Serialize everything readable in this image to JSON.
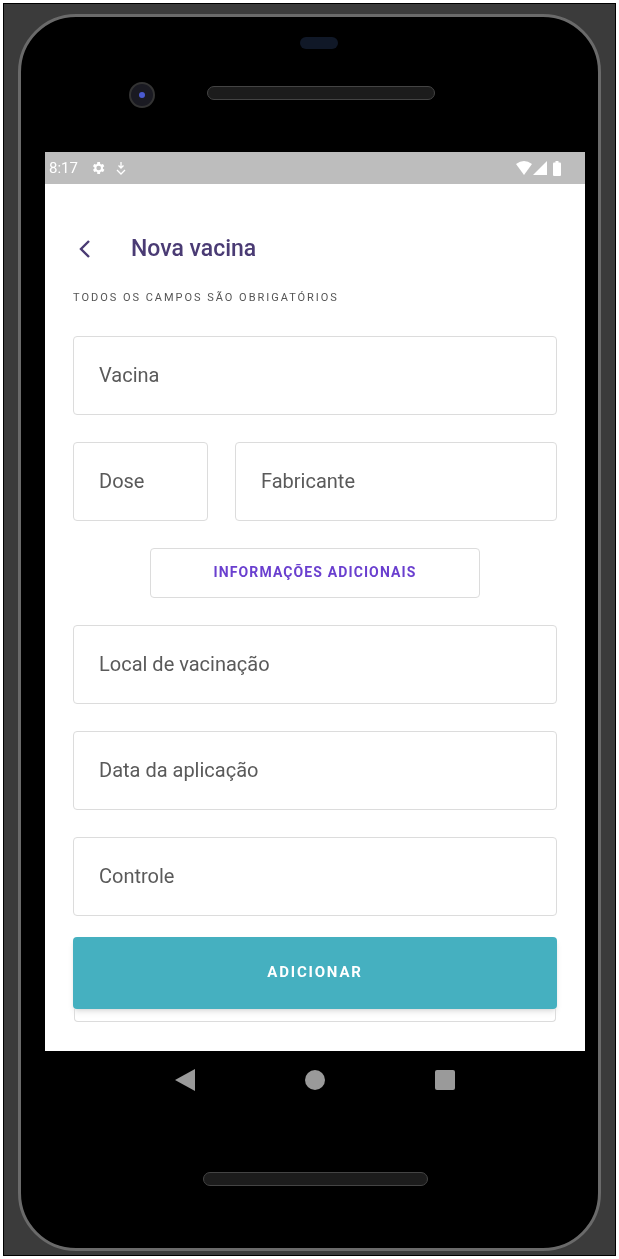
{
  "status_bar": {
    "time": "8:17"
  },
  "header": {
    "title": "Nova vacina"
  },
  "note": "TODOS OS CAMPOS SÃO OBRIGATÓRIOS",
  "fields_top": [
    {
      "placeholder": "Vacina"
    }
  ],
  "fields_row": [
    {
      "placeholder": "Dose"
    },
    {
      "placeholder": "Fabricante"
    }
  ],
  "more_button": "INFORMAÇÕES ADICIONAIS",
  "fields_extra": [
    {
      "placeholder": "Local de vacinação"
    },
    {
      "placeholder": "Data da aplicação"
    },
    {
      "placeholder": "Controle"
    }
  ],
  "submit_button": "ADICIONAR"
}
